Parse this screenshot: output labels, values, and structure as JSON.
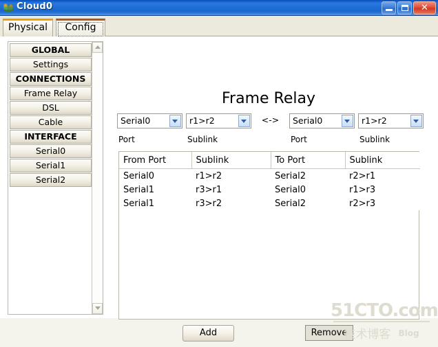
{
  "window": {
    "title": "Cloud0",
    "icon": "cloud-device-icon",
    "buttons": {
      "minimize": "minimize-button",
      "maximize": "maximize-button",
      "close_glyph": "✕"
    }
  },
  "tabs": [
    {
      "label": "Physical",
      "selected": false
    },
    {
      "label": "Config",
      "selected": true
    }
  ],
  "sidebar": {
    "items": [
      {
        "label": "GLOBAL",
        "type": "header"
      },
      {
        "label": "Settings",
        "type": "item"
      },
      {
        "label": "CONNECTIONS",
        "type": "header"
      },
      {
        "label": "Frame Relay",
        "type": "item"
      },
      {
        "label": "DSL",
        "type": "item"
      },
      {
        "label": "Cable",
        "type": "item"
      },
      {
        "label": "INTERFACE",
        "type": "header"
      },
      {
        "label": "Serial0",
        "type": "item"
      },
      {
        "label": "Serial1",
        "type": "item"
      },
      {
        "label": "Serial2",
        "type": "item"
      }
    ],
    "scrollbar": {
      "up_icon": "scroll-up-arrow-icon",
      "down_icon": "scroll-down-arrow-icon"
    }
  },
  "main": {
    "title": "Frame Relay",
    "selectors": {
      "from_port": "Serial0",
      "from_sublink": "r1>r2",
      "separator": "<->",
      "to_port": "Serial0",
      "to_sublink": "r1>r2",
      "label_port_left": "Port",
      "label_sublink_left": "Sublink",
      "label_port_right": "Port",
      "label_sublink_right": "Sublink"
    },
    "table": {
      "headers": [
        "From Port",
        "Sublink",
        "To Port",
        "Sublink"
      ],
      "rows": [
        [
          "Serial0",
          "r1>r2",
          "Serial2",
          "r2>r1"
        ],
        [
          "Serial1",
          "r3>r1",
          "Serial0",
          "r1>r3"
        ],
        [
          "Serial1",
          "r3>r2",
          "Serial2",
          "r2>r3"
        ]
      ]
    },
    "buttons": {
      "add": "Add",
      "remove": "Remove"
    }
  },
  "watermark": {
    "main": "51CTO.com",
    "sub": "技术博客",
    "blog": "Blog"
  },
  "colors": {
    "titlebar_blue": "#1f6fd8",
    "close_red": "#cf3a24",
    "window_beige": "#f4f3ec",
    "tab_strip": "#ece9dd",
    "tab_accent_orange": "#f0a000",
    "border_gray": "#b9b6ab"
  }
}
